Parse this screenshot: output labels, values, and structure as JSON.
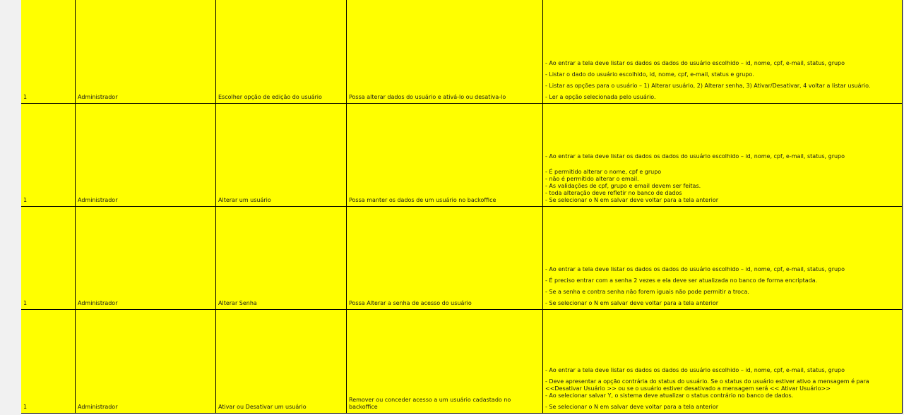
{
  "rows": [
    {
      "id": "1",
      "role": "Administrador",
      "action": "Escolher opção de edição do usuário",
      "goal": "Possa alterar dados do usuário e ativá-lo ou desativa-lo",
      "criteria": [
        "- Ao entrar a tela deve listar os dados os dados do usuário escolhido – id, nome, cpf, e-mail, status, grupo",
        "- Listar o dado do usuário escolhido, id, nome, cpf, e-mail, status e grupo.",
        "- Listar as opções para o usuário – 1) Alterar usuário, 2) Alterar senha, 3) Ativar/Desativar, 4 voltar a listar usuário.",
        "- Ler a opção selecionada pelo usuário."
      ]
    },
    {
      "id": "1",
      "role": "Administrador",
      "action": "Alterar um usuário",
      "goal": "Possa manter os dados de um usuário no backoffice",
      "criteria": [
        "- Ao entrar a tela deve listar os dados os dados do usuário escolhido – id, nome, cpf, e-mail, status, grupo",
        "- É permitido alterar o nome, cpf e grupo",
        "- não é permitido alterar o email.",
        "- As validações de cpf, grupo e email devem ser feitas.",
        "- toda alteração deve refletir no banco de dados",
        "- Se selecionar o N em salvar deve voltar para a tela anterior"
      ]
    },
    {
      "id": "1",
      "role": "Administrador",
      "action": "Alterar Senha",
      "goal": "Possa Alterar a senha de acesso do usuário",
      "criteria": [
        "- Ao entrar a tela deve listar os dados os dados do usuário escolhido – id, nome, cpf, e-mail, status, grupo",
        "- É preciso entrar com a senha 2 vezes e ela deve ser atualizada no banco de forma encriptada.",
        "- Se a senha e contra senha não forem iguais não pode permitir a troca.",
        "- Se selecionar o N em salvar deve voltar para a tela anterior"
      ]
    },
    {
      "id": "1",
      "role": "Administrador",
      "action": "Ativar ou Desativar um usuário",
      "goal": "Remover ou conceder acesso a um usuário cadastado no backoffice",
      "criteria": [
        "- Ao entrar a tela deve listar os dados os dados do usuário escolhido – id, nome, cpf, e-mail, status, grupo",
        "- Deve apresentar a opção contrária do status do usuário. Se o status do usuário estiver ativo a mensagem é para <<Desativar Usuário >> ou se o usuário estiver desativado a mensagem será << Ativar Usuário>>",
        "- Ao selecionar salvar Y, o sistema deve atualizar o status contrário no banco de dados.",
        "- Se selecionar o N em salvar deve voltar para a tela anterior"
      ]
    }
  ],
  "colors": {
    "row_background": "#ffff00",
    "border": "#000000",
    "page_background": "#ffffff",
    "outer_background": "#f1f1f1"
  }
}
